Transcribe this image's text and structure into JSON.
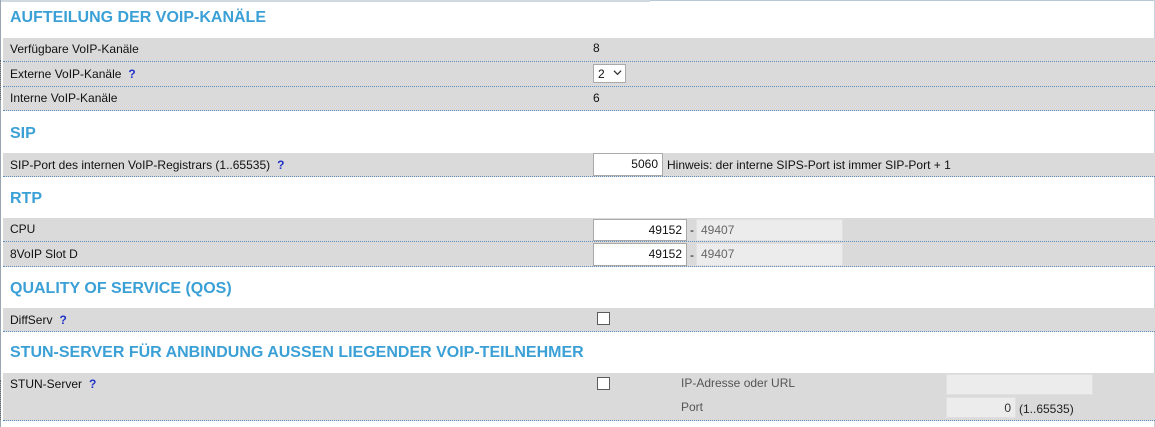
{
  "sections": {
    "voip_channels": {
      "title": "AUFTEILUNG DER VOIP-KANÄLE",
      "available_label": "Verfügbare VoIP-Kanäle",
      "available_value": "8",
      "external_label": "Externe VoIP-Kanäle",
      "external_value": "2",
      "internal_label": "Interne VoIP-Kanäle",
      "internal_value": "6"
    },
    "sip": {
      "title": "SIP",
      "port_label": "SIP-Port des internen VoIP-Registrars (1..65535)",
      "port_value": "5060",
      "hint": "Hinweis: der interne SIPS-Port ist immer SIP-Port + 1"
    },
    "rtp": {
      "title": "RTP",
      "rows": [
        {
          "label": "CPU",
          "start": "49152",
          "end": "49407"
        },
        {
          "label": "8VoIP Slot D",
          "start": "49152",
          "end": "49407"
        }
      ],
      "dash": "-"
    },
    "qos": {
      "title": "QUALITY OF SERVICE (QOS)",
      "diffserv_label": "DiffServ",
      "diffserv_checked": false
    },
    "stun": {
      "title": "STUN-SERVER FÜR ANBINDUNG AUSSEN LIEGENDER VOIP-TEILNEHMER",
      "server_label": "STUN-Server",
      "server_checked": false,
      "address_label": "IP-Adresse oder URL",
      "address_value": "",
      "port_label": "Port",
      "port_value": "0",
      "port_range": "(1..65535)"
    }
  },
  "help_glyph": "?",
  "colors": {
    "heading": "#3aa0d6",
    "row_bg": "#dadada",
    "help": "#1f33c9",
    "divider": "#5b8dc0"
  },
  "icons": {
    "help": "question-mark-icon",
    "dropdown": "chevron-down-icon"
  }
}
